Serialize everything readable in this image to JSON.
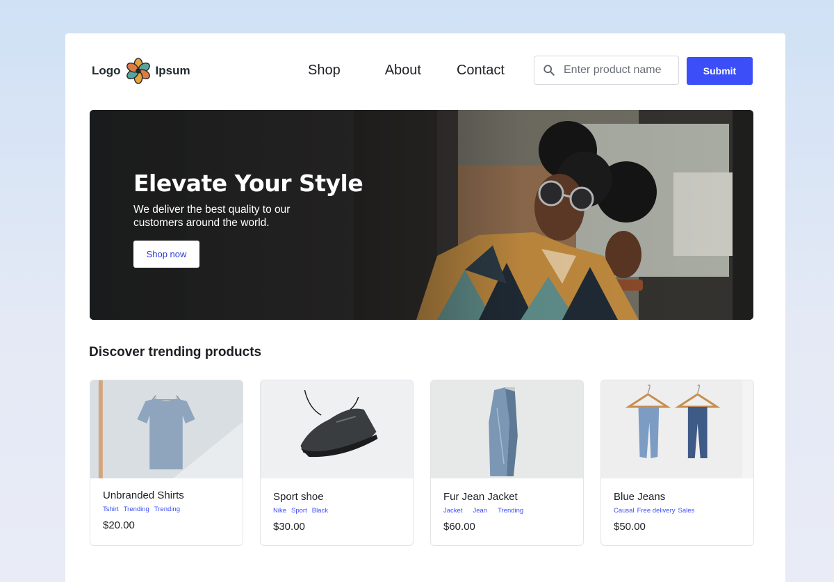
{
  "header": {
    "logo_left": "Logo",
    "logo_right": "Ipsum",
    "nav": [
      "Shop",
      "About",
      "Contact"
    ],
    "search_placeholder": "Enter product name",
    "submit_label": "Submit"
  },
  "hero": {
    "title": "Elevate Your Style",
    "subtitle": "We deliver the best quality to our customers around the world.",
    "cta_label": "Shop now"
  },
  "section_title": "Discover trending products",
  "products": [
    {
      "name": "Unbranded Shirts",
      "tags": [
        "Tshirt",
        "Trending",
        "Trending"
      ],
      "price": "$20.00"
    },
    {
      "name": "Sport shoe",
      "tags": [
        "Nike",
        "Sport",
        "Black"
      ],
      "price": "$30.00"
    },
    {
      "name": "Fur Jean Jacket",
      "tags": [
        "Jacket",
        "Jean",
        "Trending"
      ],
      "price": "$60.00"
    },
    {
      "name": "Blue Jeans",
      "tags": [
        "Causal",
        "Free delivery",
        "Sales"
      ],
      "price": "$50.00"
    }
  ],
  "colors": {
    "accent": "#3b4ef8",
    "text": "#1d1f24"
  }
}
